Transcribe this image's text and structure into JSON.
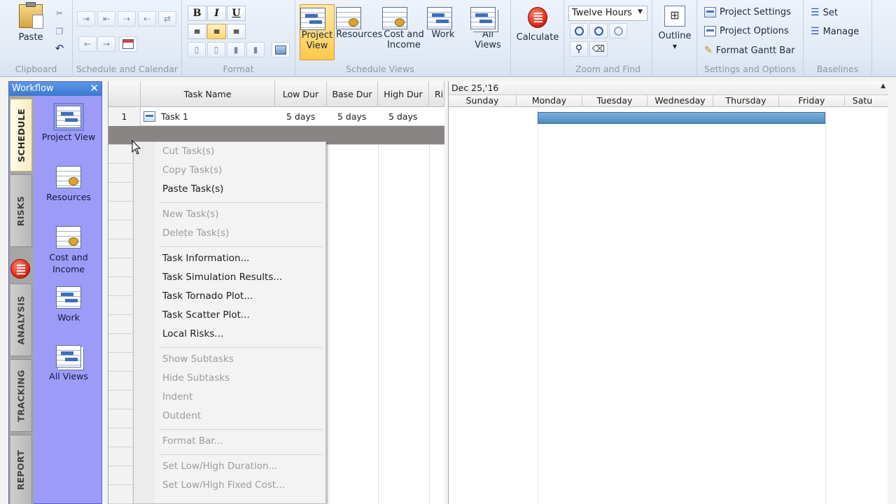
{
  "ribbon": {
    "clipboard": {
      "label": "Clipboard",
      "paste": "Paste"
    },
    "schedule_calendar": {
      "label": "Schedule and Calendar"
    },
    "format": {
      "label": "Format",
      "bold": "B",
      "italic": "I",
      "underline": "U"
    },
    "schedule_views": {
      "label": "Schedule Views",
      "project_view": "Project\nView",
      "resources": "Resources",
      "cost_income": "Cost and\nIncome",
      "work": "Work"
    },
    "all_views": "All\nViews",
    "calculate": "Calculate",
    "zoom": {
      "label": "Zoom and Find",
      "select_value": "Twelve Hours"
    },
    "outline": "Outline",
    "settings": {
      "label": "Settings and Options",
      "project_settings": "Project Settings",
      "project_options": "Project Options",
      "format_gantt": "Format Gantt Bar"
    },
    "baselines": {
      "label": "Baselines",
      "set": "Set",
      "manage": "Manage"
    }
  },
  "workflow": {
    "title": "Workflow",
    "close": "✕",
    "tabs": [
      "SCHEDULE",
      "RISKS",
      "ANALYSIS",
      "TRACKING",
      "REPORT"
    ],
    "items": [
      "Project View",
      "Resources",
      "Cost and\nIncome",
      "Work",
      "All Views"
    ]
  },
  "grid": {
    "columns": [
      "Task Name",
      "Low Dur",
      "Base Dur",
      "High Dur",
      "Ri"
    ],
    "rows": [
      {
        "num": "1",
        "name": "Task 1",
        "low": "5 days",
        "base": "5 days",
        "high": "5 days"
      }
    ]
  },
  "gantt": {
    "date": "Dec 25,'16",
    "days": [
      "Sunday",
      "Monday",
      "Tuesday",
      "Wednesday",
      "Thursday",
      "Friday",
      "Satu"
    ]
  },
  "context_menu": {
    "items": [
      {
        "label": "Cut Task(s)",
        "enabled": false
      },
      {
        "label": "Copy Task(s)",
        "enabled": false
      },
      {
        "label": "Paste Task(s)",
        "enabled": true
      },
      {
        "label": "New Task(s)",
        "enabled": false
      },
      {
        "label": "Delete Task(s)",
        "enabled": false
      },
      {
        "label": "Task Information...",
        "enabled": true
      },
      {
        "label": "Task Simulation Results...",
        "enabled": true
      },
      {
        "label": "Task Tornado Plot...",
        "enabled": true
      },
      {
        "label": "Task Scatter Plot...",
        "enabled": true
      },
      {
        "label": "Local Risks...",
        "enabled": true
      },
      {
        "label": "Show Subtasks",
        "enabled": false
      },
      {
        "label": "Hide Subtasks",
        "enabled": false
      },
      {
        "label": "Indent",
        "enabled": false
      },
      {
        "label": "Outdent",
        "enabled": false
      },
      {
        "label": "Format Bar...",
        "enabled": false
      },
      {
        "label": "Set Low/High Duration...",
        "enabled": false
      },
      {
        "label": "Set Low/High Fixed Cost...",
        "enabled": false
      }
    ]
  },
  "colors": {
    "workflow_bg": "#9c9cf8",
    "gantt_bar": "#4d8ac2",
    "selected_row": "#8a8585",
    "active_button": "#ffd66e"
  }
}
